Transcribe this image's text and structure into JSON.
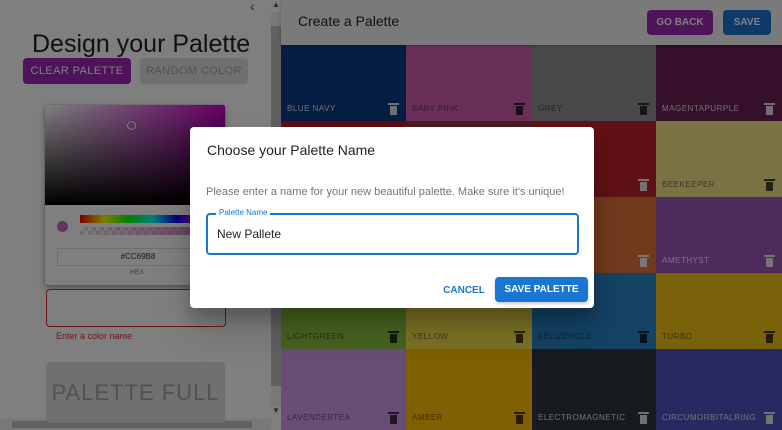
{
  "sidebar": {
    "title": "Design your Palette",
    "clear_label": "CLEAR PALETTE",
    "random_label": "RANDOM COLOR",
    "hex_value": "#CC69B8",
    "hex_label": "HEX",
    "color_name_value": "",
    "helper_text": "Enter a color name",
    "full_label": "PALETTE FULL",
    "collapse_icon": "chevron-left-icon"
  },
  "appbar": {
    "title": "Create a Palette",
    "go_back_label": "GO BACK",
    "save_label": "SAVE"
  },
  "colors": [
    {
      "name": "BLUE NAVY",
      "color": "#0c3a86",
      "dark": true
    },
    {
      "name": "BABY PINK",
      "color": "#d35fb0",
      "dark": false
    },
    {
      "name": "GREY",
      "color": "#8f9296",
      "dark": false
    },
    {
      "name": "MAGENTAPURPLE",
      "color": "#6c1f55",
      "dark": true
    },
    {
      "name": "",
      "color": "#b81d24",
      "dark": true
    },
    {
      "name": "",
      "color": "#8d3a3a",
      "dark": true
    },
    {
      "name": "",
      "color": "#c0232a",
      "dark": true
    },
    {
      "name": "BEEKEEPER",
      "color": "#f4e38a",
      "dark": false
    },
    {
      "name": "",
      "color": "#e44e25",
      "dark": true
    },
    {
      "name": "",
      "color": "#e06d2a",
      "dark": true
    },
    {
      "name": "",
      "color": "#e4743a",
      "dark": true
    },
    {
      "name": "AMETHYST",
      "color": "#9b59b6",
      "dark": true
    },
    {
      "name": "LIGHTGREEN",
      "color": "#8dc63f",
      "dark": false
    },
    {
      "name": "YELLOW",
      "color": "#f7e34b",
      "dark": false
    },
    {
      "name": "BELIZEHOLE",
      "color": "#2886c9",
      "dark": false
    },
    {
      "name": "TURBO",
      "color": "#f4c414",
      "dark": false
    },
    {
      "name": "LAVENDERTEA",
      "color": "#d49bed",
      "dark": false
    },
    {
      "name": "AMBER",
      "color": "#ffc107",
      "dark": false
    },
    {
      "name": "ELECTROMAGNETIC",
      "color": "#2f3640",
      "dark": true
    },
    {
      "name": "CIRCUMORBITALRING",
      "color": "#5352c4",
      "dark": true
    }
  ],
  "dialog": {
    "title": "Choose your Palette Name",
    "text": "Please enter a name for your new beautiful palette. Make sure it's unique!",
    "field_label": "Palette Name",
    "field_value": "New Pallete",
    "cancel_label": "CANCEL",
    "save_label": "SAVE PALETTE"
  }
}
